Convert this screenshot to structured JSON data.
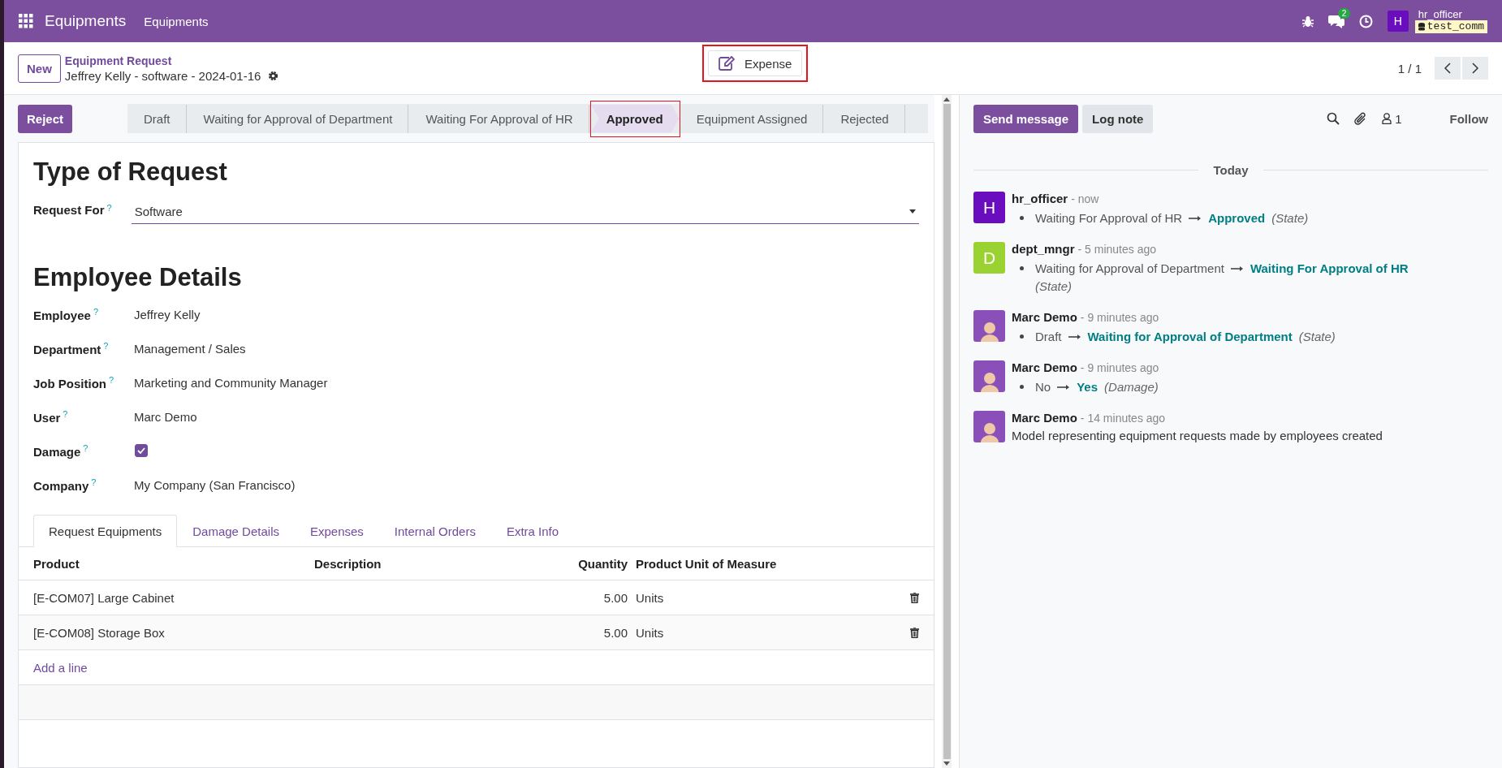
{
  "navbar": {
    "app_name": "Equipments",
    "menu": [
      "Equipments"
    ],
    "chat_badge": "2",
    "avatar_letter": "H",
    "user": "hr_officer",
    "database": "test_comm"
  },
  "control_panel": {
    "new_button": "New",
    "breadcrumb": "Equipment Request",
    "record": "Jeffrey Kelly - software - 2024-01-16",
    "action": {
      "label": "Expense",
      "highlighted": true
    },
    "pager": "1 / 1"
  },
  "status": {
    "reject_button": "Reject",
    "stages": [
      {
        "label": "Draft",
        "selected": false,
        "highlighted": false
      },
      {
        "label": "Waiting for Approval of Department",
        "selected": false,
        "highlighted": false
      },
      {
        "label": "Waiting For Approval of HR",
        "selected": false,
        "highlighted": false
      },
      {
        "label": "Approved",
        "selected": true,
        "highlighted": true
      },
      {
        "label": "Equipment Assigned",
        "selected": false,
        "highlighted": false
      },
      {
        "label": "Rejected",
        "selected": false,
        "highlighted": false
      }
    ]
  },
  "form": {
    "section_1": "Type of Request",
    "request_for": {
      "label": "Request For",
      "help": "?",
      "value": "Software"
    },
    "section_2": "Employee Details",
    "fields": [
      {
        "kind": "text",
        "label": "Employee",
        "help": "?",
        "value": "Jeffrey Kelly"
      },
      {
        "kind": "text",
        "label": "Department",
        "help": "?",
        "value": "Management / Sales"
      },
      {
        "kind": "text",
        "label": "Job Position",
        "help": "?",
        "value": "Marketing and Community Manager"
      },
      {
        "kind": "text",
        "label": "User",
        "help": "?",
        "value": "Marc Demo"
      },
      {
        "kind": "checkbox",
        "label": "Damage",
        "help": "?",
        "checked": true
      },
      {
        "kind": "text",
        "label": "Company",
        "help": "?",
        "value": "My Company (San Francisco)"
      }
    ],
    "tabs": [
      {
        "label": "Request Equipments",
        "selected": true
      },
      {
        "label": "Damage Details",
        "selected": false
      },
      {
        "label": "Expenses",
        "selected": false
      },
      {
        "label": "Internal Orders",
        "selected": false
      },
      {
        "label": "Extra Info",
        "selected": false
      }
    ],
    "table": {
      "columns": [
        "Product",
        "Description",
        "Quantity",
        "Product Unit of Measure"
      ],
      "rows": [
        {
          "product": "[E-COM07] Large Cabinet",
          "description": "",
          "quantity": "5.00",
          "uom": "Units"
        },
        {
          "product": "[E-COM08] Storage Box",
          "description": "",
          "quantity": "5.00",
          "uom": "Units"
        }
      ],
      "add_line": "Add a line"
    }
  },
  "chatter": {
    "send_message": "Send message",
    "log_note": "Log note",
    "followers": "1",
    "follow": "Follow",
    "date_separator": "Today",
    "messages": [
      {
        "author": "hr_officer",
        "time": "- now",
        "avatar": {
          "kind": "letter",
          "letter": "H",
          "color": "#6a0dbe"
        },
        "changes": [
          {
            "from": "Waiting For Approval of HR",
            "to": "Approved",
            "field": "(State)"
          }
        ]
      },
      {
        "author": "dept_mngr",
        "time": "- 5 minutes ago",
        "avatar": {
          "kind": "letter",
          "letter": "D",
          "color": "#9ad232"
        },
        "changes": [
          {
            "from": "Waiting for Approval of Department",
            "to": "Waiting For Approval of HR",
            "field": "(State)"
          }
        ]
      },
      {
        "author": "Marc Demo",
        "time": "- 9 minutes ago",
        "avatar": {
          "kind": "photo"
        },
        "changes": [
          {
            "from": "Draft",
            "to": "Waiting for Approval of Department",
            "field": "(State)"
          }
        ]
      },
      {
        "author": "Marc Demo",
        "time": "- 9 minutes ago",
        "avatar": {
          "kind": "photo"
        },
        "changes": [
          {
            "from": "No",
            "to": "Yes",
            "field": "(Damage)"
          }
        ]
      },
      {
        "author": "Marc Demo",
        "time": "- 14 minutes ago",
        "avatar": {
          "kind": "photo"
        },
        "body": "Model representing equipment requests made by employees created"
      }
    ]
  }
}
